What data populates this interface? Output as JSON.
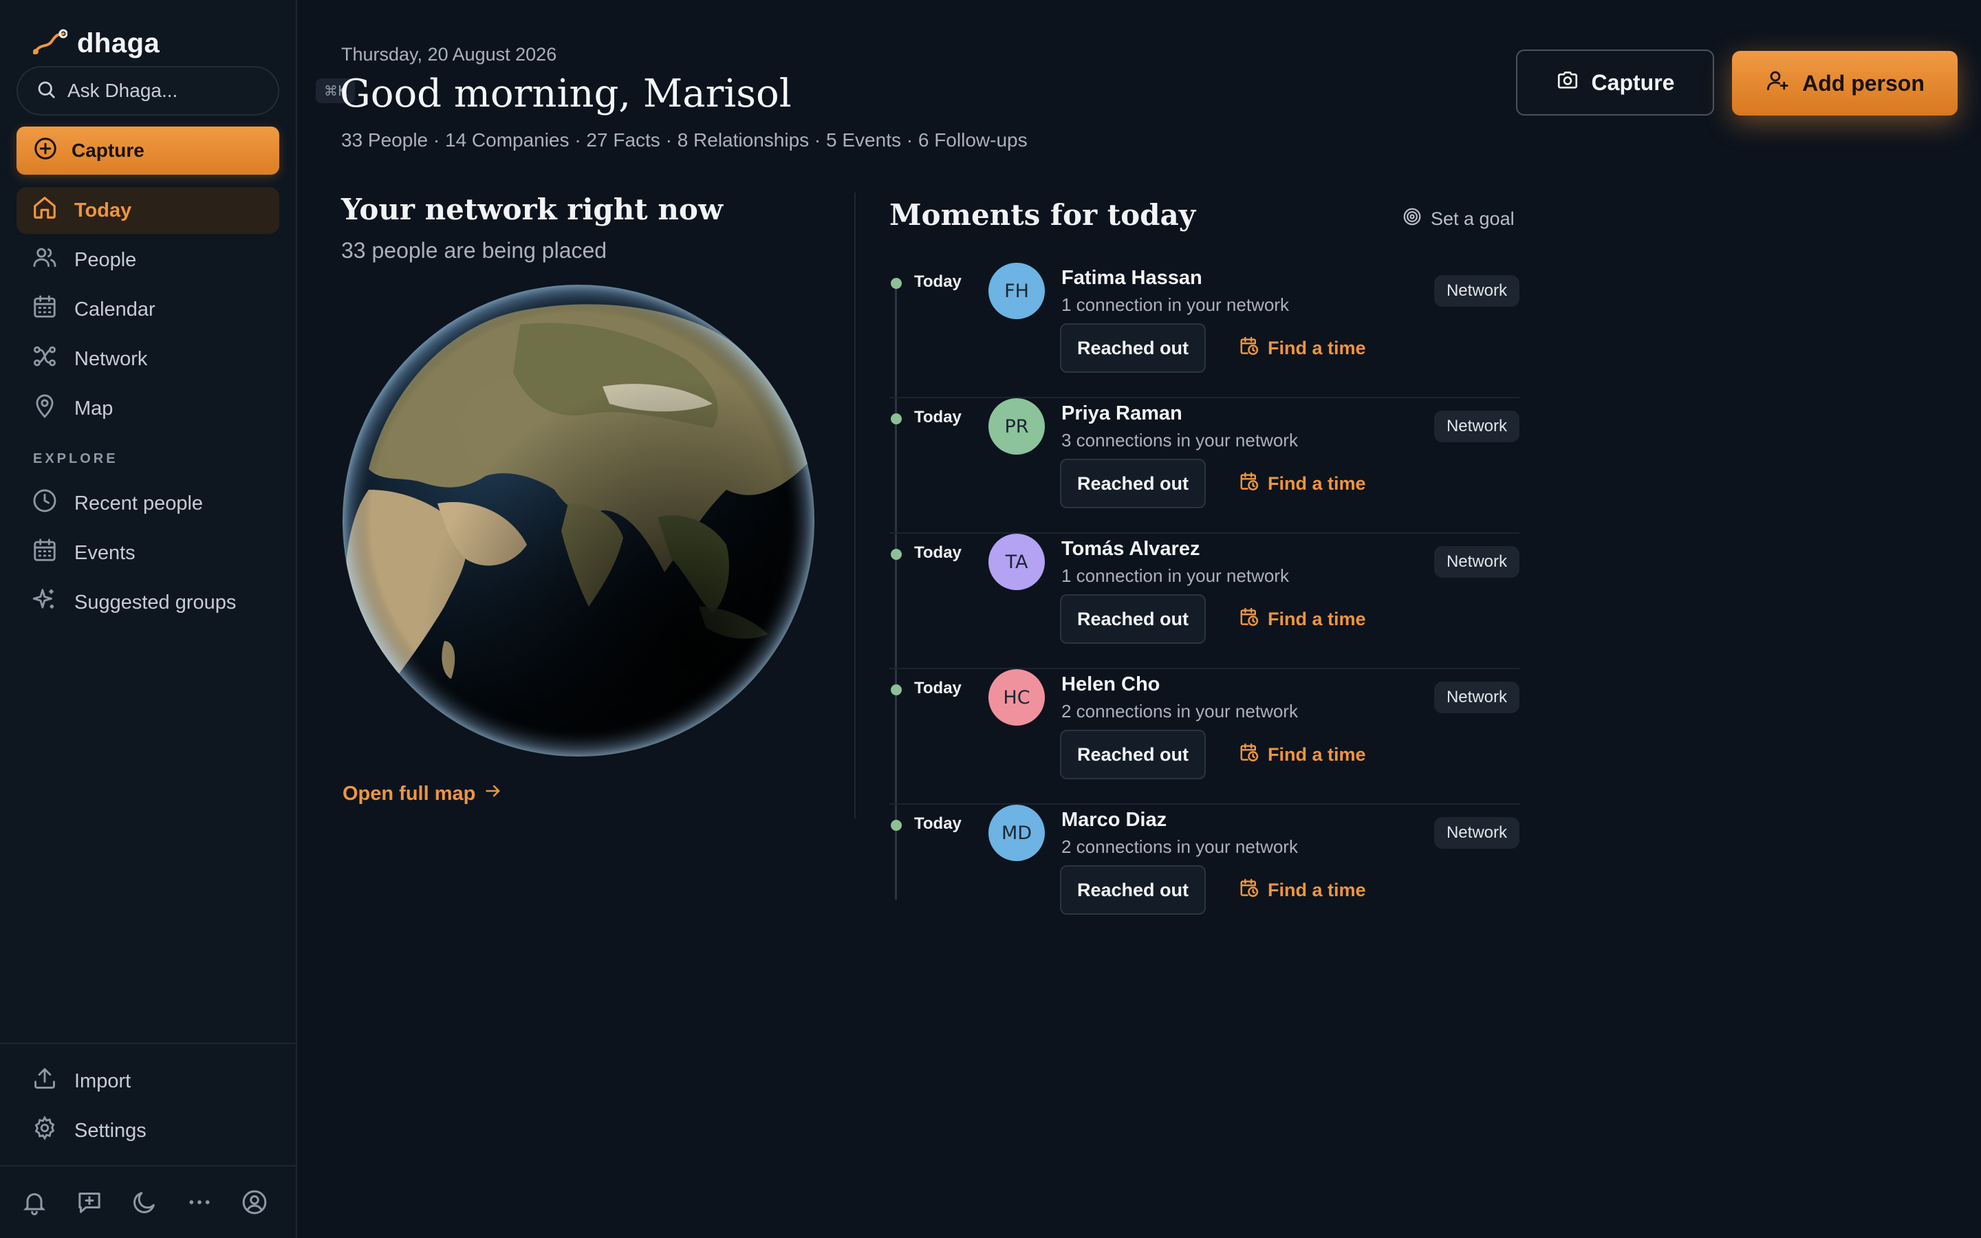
{
  "app": {
    "brand": "dhaga",
    "accent": "#f0953c"
  },
  "search": {
    "placeholder": "Ask Dhaga...",
    "shortcut": "⌘K"
  },
  "sidebar": {
    "capture_label": "Capture",
    "nav": [
      {
        "label": "Today",
        "icon": "home-icon",
        "active": true
      },
      {
        "label": "People",
        "icon": "people-icon"
      },
      {
        "label": "Calendar",
        "icon": "calendar-icon"
      },
      {
        "label": "Network",
        "icon": "network-icon"
      },
      {
        "label": "Map",
        "icon": "map-pin-icon"
      }
    ],
    "explore_label": "EXPLORE",
    "explore": [
      {
        "label": "Recent people",
        "icon": "clock-icon"
      },
      {
        "label": "Events",
        "icon": "calendar-icon"
      },
      {
        "label": "Suggested groups",
        "icon": "sparkles-icon"
      }
    ],
    "bottom": [
      {
        "label": "Import",
        "icon": "upload-icon"
      },
      {
        "label": "Settings",
        "icon": "gear-icon"
      }
    ],
    "footer_icons": [
      "bell-icon",
      "chat-plus-icon",
      "moon-icon",
      "more-icon",
      "user-circle-icon"
    ]
  },
  "header": {
    "date": "Thursday, 20 August 2026",
    "greeting": "Good morning, Marisol",
    "stats": "33 People · 14 Companies · 27 Facts · 8 Relationships · 5 Events · 6 Follow-ups",
    "capture_label": "Capture",
    "add_person_label": "Add person"
  },
  "network": {
    "title": "Your network right now",
    "subtitle": "33 people are being placed",
    "open_map_label": "Open full map"
  },
  "moments": {
    "title": "Moments for today",
    "set_goal_label": "Set a goal",
    "reached_label": "Reached out",
    "find_label": "Find a time",
    "items": [
      {
        "when": "Today",
        "initials": "FH",
        "name": "Fatima Hassan",
        "connections": "1 connection in your network",
        "badge": "Network",
        "avatar_color": "#6db3e3"
      },
      {
        "when": "Today",
        "initials": "PR",
        "name": "Priya Raman",
        "connections": "3 connections in your network",
        "badge": "Network",
        "avatar_color": "#8cc39b"
      },
      {
        "when": "Today",
        "initials": "TA",
        "name": "Tomás Alvarez",
        "connections": "1 connection in your network",
        "badge": "Network",
        "avatar_color": "#b3a3f2"
      },
      {
        "when": "Today",
        "initials": "HC",
        "name": "Helen Cho",
        "connections": "2 connections in your network",
        "badge": "Network",
        "avatar_color": "#f0929e"
      },
      {
        "when": "Today",
        "initials": "MD",
        "name": "Marco Diaz",
        "connections": "2 connections in your network",
        "badge": "Network",
        "avatar_color": "#6db3e3"
      }
    ]
  }
}
